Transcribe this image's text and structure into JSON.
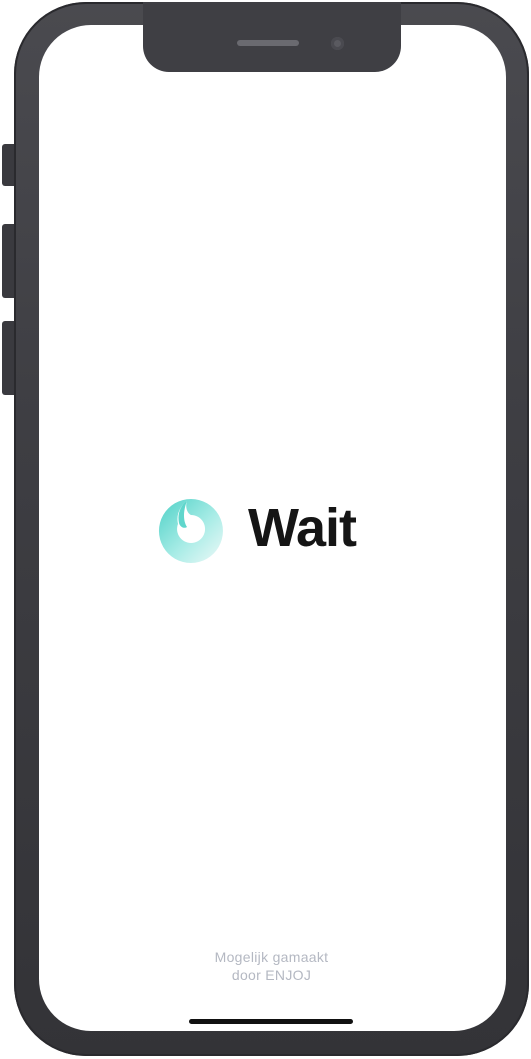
{
  "app": {
    "name": "Wait",
    "logo_icon": "ring-drop-logo-icon",
    "logo_colors": [
      "#4fd1c7",
      "#a8ece6",
      "#e8f8f7"
    ]
  },
  "footer": {
    "credit_line1": "Mogelijk gamaakt",
    "credit_line2": "door ENJOJ"
  },
  "colors": {
    "brand_text": "#151515",
    "credit_text": "#b4b8c2",
    "frame": "#3e3e43"
  }
}
